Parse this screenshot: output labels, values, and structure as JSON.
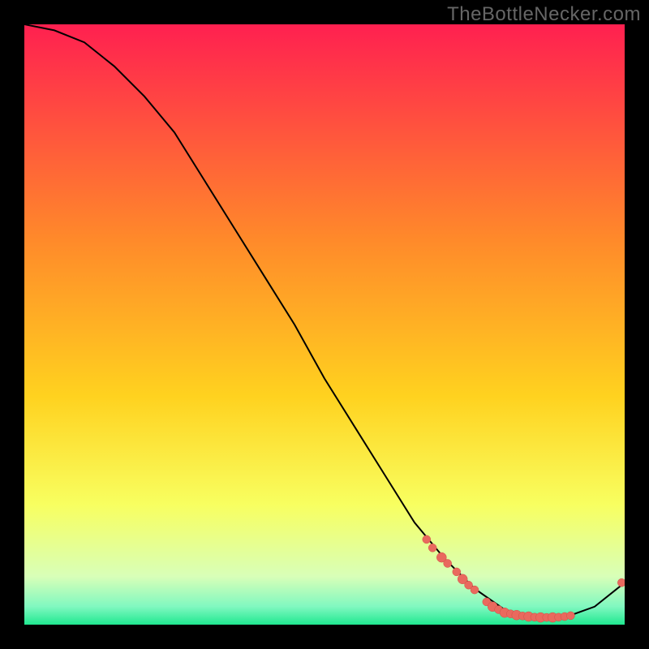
{
  "watermark": "TheBottleNecker.com",
  "colors": {
    "dot": "#e9695e",
    "dot_stroke": "#d14f45",
    "curve": "#000000",
    "bg_black": "#000000",
    "grad_top": "#ff2050",
    "grad_mid1": "#ff6a2a",
    "grad_mid2": "#ffd21f",
    "grad_mid3": "#f8ff60",
    "grad_mid4": "#b8ffb0",
    "grad_bottom": "#20e890"
  },
  "chart_data": {
    "type": "line",
    "title": "",
    "xlabel": "",
    "ylabel": "",
    "xlim": [
      0,
      100
    ],
    "ylim": [
      0,
      100
    ],
    "curve": [
      {
        "x": 0,
        "y": 100
      },
      {
        "x": 5,
        "y": 99
      },
      {
        "x": 10,
        "y": 97
      },
      {
        "x": 15,
        "y": 93
      },
      {
        "x": 20,
        "y": 88
      },
      {
        "x": 25,
        "y": 82
      },
      {
        "x": 30,
        "y": 74
      },
      {
        "x": 35,
        "y": 66
      },
      {
        "x": 40,
        "y": 58
      },
      {
        "x": 45,
        "y": 50
      },
      {
        "x": 50,
        "y": 41
      },
      {
        "x": 55,
        "y": 33
      },
      {
        "x": 60,
        "y": 25
      },
      {
        "x": 65,
        "y": 17
      },
      {
        "x": 70,
        "y": 11
      },
      {
        "x": 75,
        "y": 6
      },
      {
        "x": 80,
        "y": 2.5
      },
      {
        "x": 85,
        "y": 1.2
      },
      {
        "x": 90,
        "y": 1.2
      },
      {
        "x": 95,
        "y": 3
      },
      {
        "x": 100,
        "y": 7
      }
    ],
    "points": [
      {
        "x": 67,
        "y": 14.2,
        "r": 5
      },
      {
        "x": 68,
        "y": 12.8,
        "r": 5
      },
      {
        "x": 69.5,
        "y": 11.2,
        "r": 6
      },
      {
        "x": 70.5,
        "y": 10.2,
        "r": 5
      },
      {
        "x": 72,
        "y": 8.8,
        "r": 5
      },
      {
        "x": 73,
        "y": 7.6,
        "r": 6
      },
      {
        "x": 74,
        "y": 6.6,
        "r": 5
      },
      {
        "x": 75,
        "y": 5.8,
        "r": 5
      },
      {
        "x": 77,
        "y": 3.8,
        "r": 5
      },
      {
        "x": 78,
        "y": 3.0,
        "r": 6
      },
      {
        "x": 79,
        "y": 2.5,
        "r": 5
      },
      {
        "x": 80,
        "y": 2.0,
        "r": 6
      },
      {
        "x": 81,
        "y": 1.8,
        "r": 5
      },
      {
        "x": 82,
        "y": 1.6,
        "r": 6
      },
      {
        "x": 83,
        "y": 1.45,
        "r": 5
      },
      {
        "x": 84,
        "y": 1.35,
        "r": 6
      },
      {
        "x": 85,
        "y": 1.25,
        "r": 5
      },
      {
        "x": 86,
        "y": 1.2,
        "r": 6
      },
      {
        "x": 87,
        "y": 1.2,
        "r": 5
      },
      {
        "x": 88,
        "y": 1.2,
        "r": 6
      },
      {
        "x": 89,
        "y": 1.25,
        "r": 5
      },
      {
        "x": 90,
        "y": 1.35,
        "r": 5
      },
      {
        "x": 91,
        "y": 1.5,
        "r": 5
      },
      {
        "x": 99.5,
        "y": 7.0,
        "r": 5
      }
    ]
  }
}
